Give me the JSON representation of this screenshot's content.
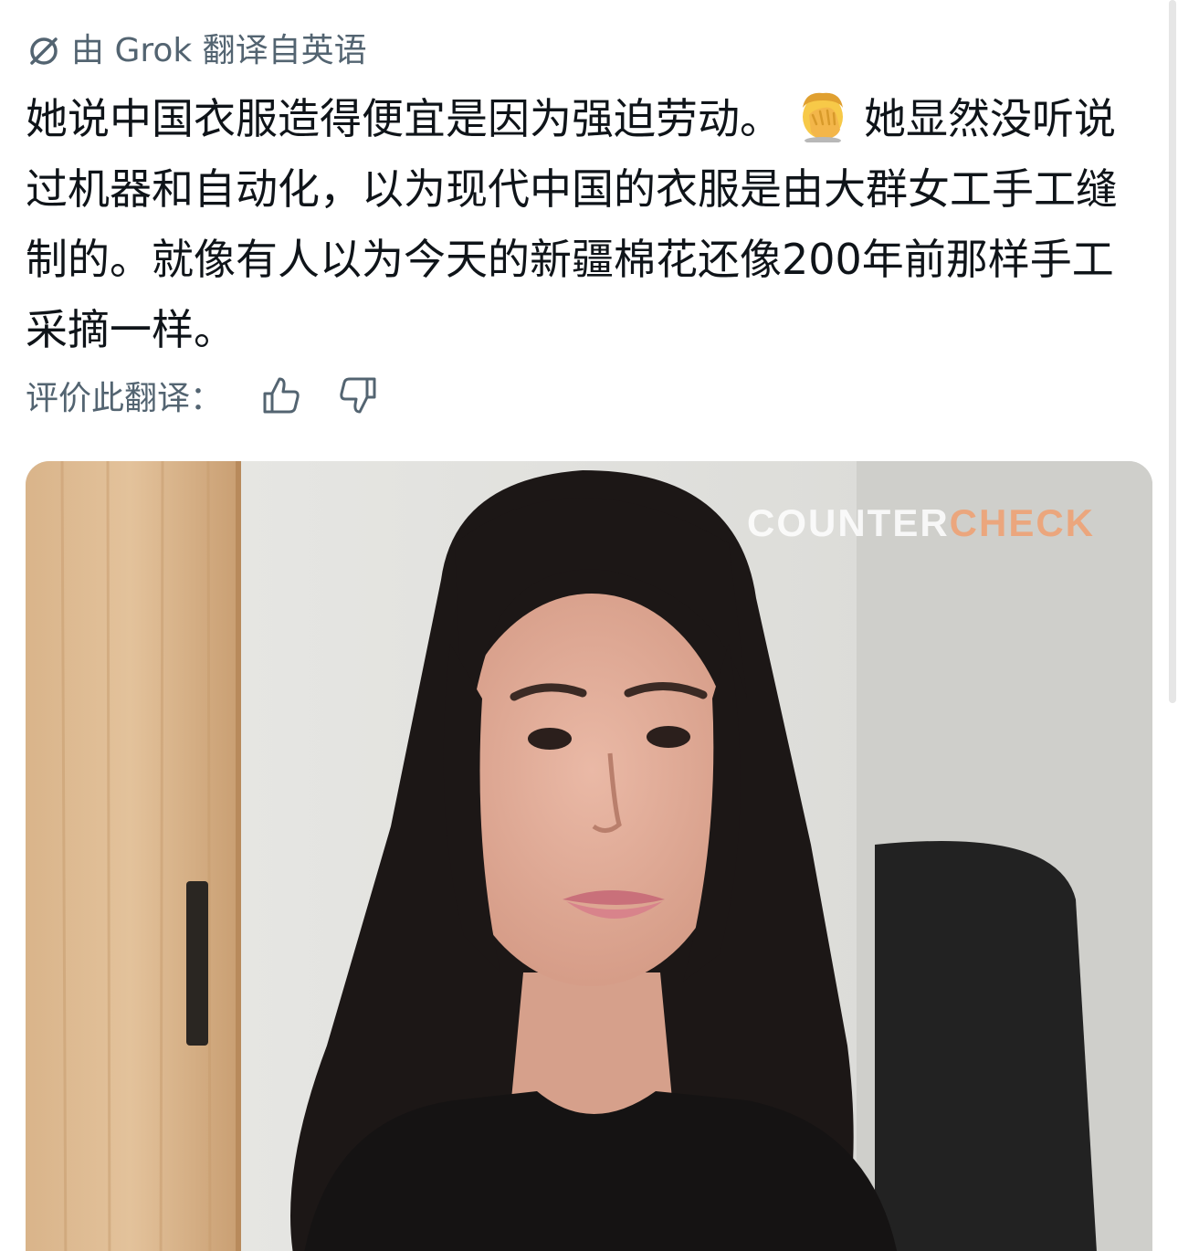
{
  "translation": {
    "label": "由 Grok 翻译自英语",
    "icon": "grok-icon"
  },
  "tweet": {
    "text_part1": "她说中国衣服造得便宜是因为强迫劳动。",
    "emoji": "🤦",
    "emoji_name": "facepalm-emoji",
    "text_part2": "她显然没听说过机器和自动化，以为现代中国的衣服是由大群女工手工缝制的。就像有人以为今天的新疆棉花还像200年前那样手工采摘一样。"
  },
  "rating": {
    "label": "评价此翻译：",
    "thumbs_up_icon": "thumbs-up-icon",
    "thumbs_down_icon": "thumbs-down-icon"
  },
  "media": {
    "watermark_part1": "COUNTER",
    "watermark_part2": "CHECK",
    "watermark_color_1": "#ffffff",
    "watermark_color_2": "#f0a070"
  },
  "colors": {
    "text_primary": "#0f1419",
    "text_secondary": "#536471"
  }
}
